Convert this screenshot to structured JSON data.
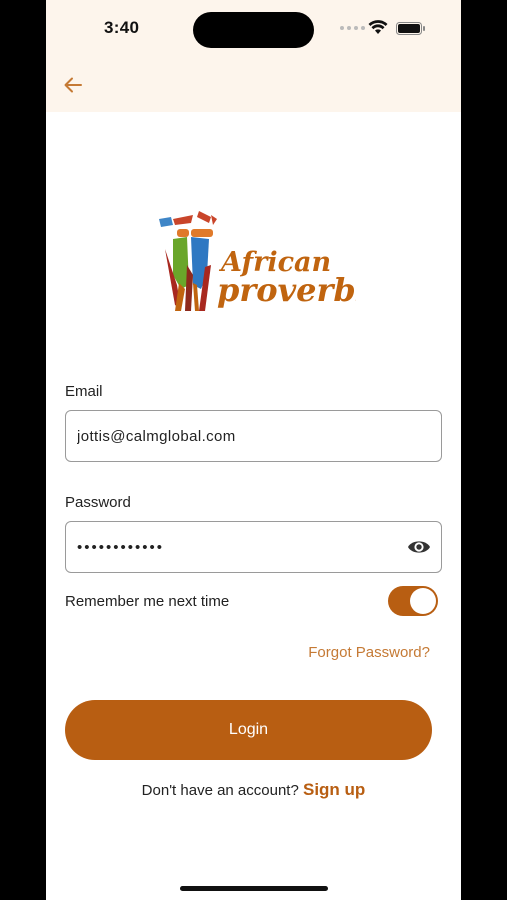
{
  "status_bar": {
    "time": "3:40"
  },
  "header": {
    "back_icon": "arrow-left-icon",
    "back_color": "#c57a35"
  },
  "logo": {
    "line1": "African",
    "line2": "proverbs",
    "brand_color": "#c0640f"
  },
  "form": {
    "email_label": "Email",
    "email_value": "jottis@calmglobal.com",
    "password_label": "Password",
    "password_value": "••••••••••••",
    "password_icon": "eye-icon",
    "remember_label": "Remember me next time",
    "remember_checked": true,
    "forgot_label": "Forgot Password?",
    "login_label": "Login"
  },
  "footer": {
    "prompt": "Don't have an account?",
    "signup_label": "Sign up"
  },
  "colors": {
    "accent": "#b85e12",
    "link": "#c57a35",
    "header_bg": "#fdf5ec"
  }
}
